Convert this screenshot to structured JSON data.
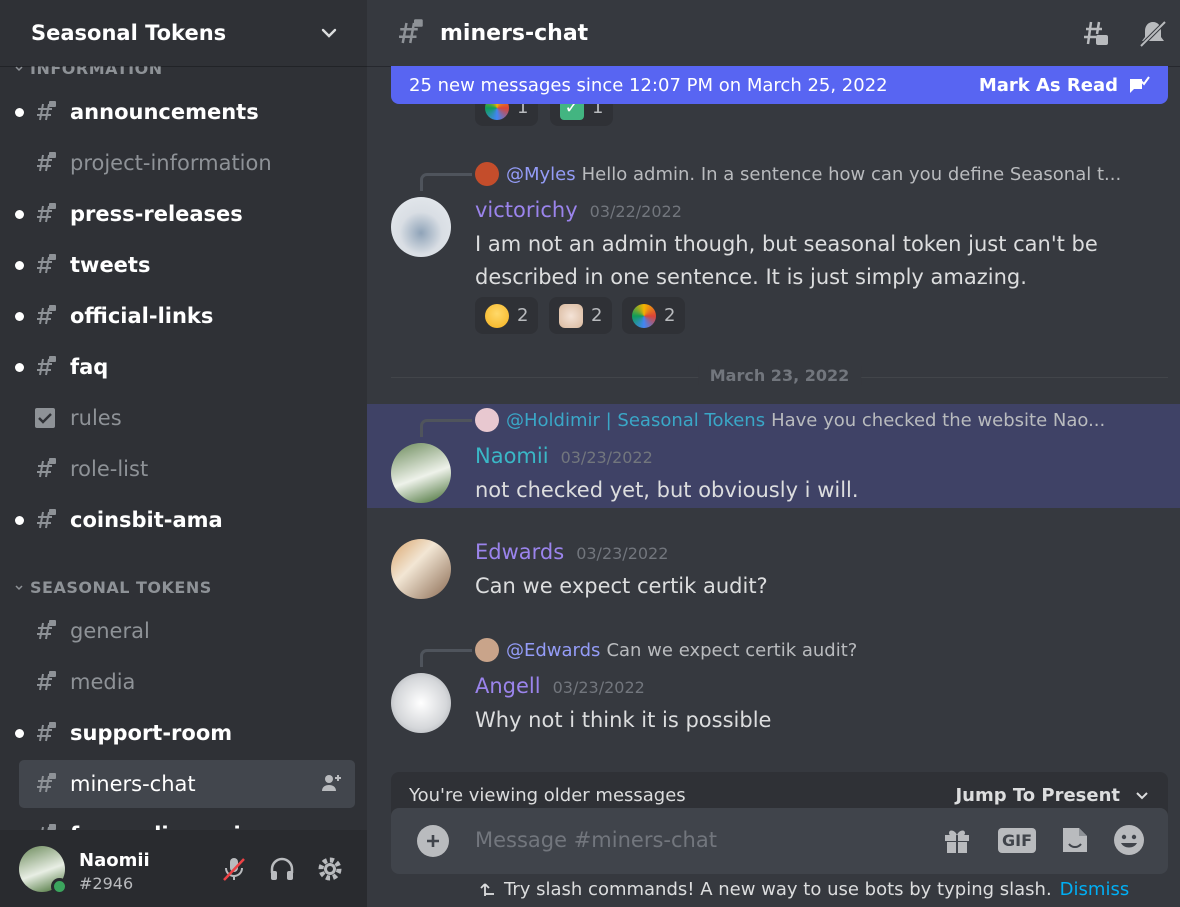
{
  "server": {
    "name": "Seasonal Tokens"
  },
  "categories": [
    {
      "label": "INFORMATION"
    },
    {
      "label": "SEASONAL TOKENS"
    }
  ],
  "channels": [
    {
      "name": "announcements",
      "unread": true
    },
    {
      "name": "project-information",
      "unread": false
    },
    {
      "name": "press-releases",
      "unread": true
    },
    {
      "name": "tweets",
      "unread": true
    },
    {
      "name": "official-links",
      "unread": true
    },
    {
      "name": "faq",
      "unread": true
    },
    {
      "name": "rules",
      "unread": false
    },
    {
      "name": "role-list",
      "unread": false
    },
    {
      "name": "coinsbit-ama",
      "unread": true
    },
    {
      "name": "general",
      "unread": false
    },
    {
      "name": "media",
      "unread": false
    },
    {
      "name": "support-room",
      "unread": true
    },
    {
      "name": "miners-chat",
      "unread": false,
      "selected": true
    },
    {
      "name": "funny-discussion",
      "unread": true
    }
  ],
  "user": {
    "name": "Naomii",
    "tag": "#2946"
  },
  "channel_header": {
    "title": "miners-chat"
  },
  "banner": {
    "text": "25 new messages since 12:07 PM on March 25, 2022",
    "action": "Mark As Read"
  },
  "top_reactions": [
    {
      "icon": "seasonal-logo-emoji",
      "count": "1"
    },
    {
      "icon": "check-mark-emoji",
      "count": "1"
    }
  ],
  "messages": [
    {
      "reply_to": "@Myles",
      "reply_text": "Hello admin. In a sentence how can you define Seasonal t...",
      "author": "victorichy",
      "author_color": "#9b84ec",
      "time": "03/22/2022",
      "lines": [
        "I am not an admin though, but seasonal token just can't be",
        "described in one sentence. It is just simply amazing."
      ],
      "reactions": [
        {
          "icon": "sweat-smile-emoji",
          "count": "2"
        },
        {
          "icon": "raised-hands-emoji",
          "count": "2"
        },
        {
          "icon": "seasonal-logo-emoji",
          "count": "2"
        }
      ]
    },
    {
      "reply_to": "@Holdimir | Seasonal Tokens",
      "reply_text": "Have you checked the website Nao...",
      "author": "Naomii",
      "author_color": "#3ab7c6",
      "time": "03/23/2022",
      "lines": [
        "not checked yet, but obviously i will."
      ]
    },
    {
      "author": "Edwards",
      "author_color": "#9b84ec",
      "time": "03/23/2022",
      "lines": [
        "Can we expect certik audit?"
      ]
    },
    {
      "reply_to": "@Edwards",
      "reply_text": "Can we expect certik audit?",
      "author": "Angell",
      "author_color": "#9b84ec",
      "time": "03/23/2022",
      "lines": [
        "Why not i think it is possible"
      ]
    }
  ],
  "divider": {
    "date": "March 23, 2022"
  },
  "older_bar": {
    "text": "You're viewing older messages",
    "jump": "Jump To Present"
  },
  "composer": {
    "placeholder": "Message #miners-chat",
    "gif_label": "GIF"
  },
  "slash_tip": {
    "text": "Try slash commands! A new way to use bots by typing slash.",
    "dismiss": "Dismiss"
  },
  "colors": {
    "accent": "#5865f2",
    "online": "#3ba55d",
    "link": "#00aff4"
  }
}
